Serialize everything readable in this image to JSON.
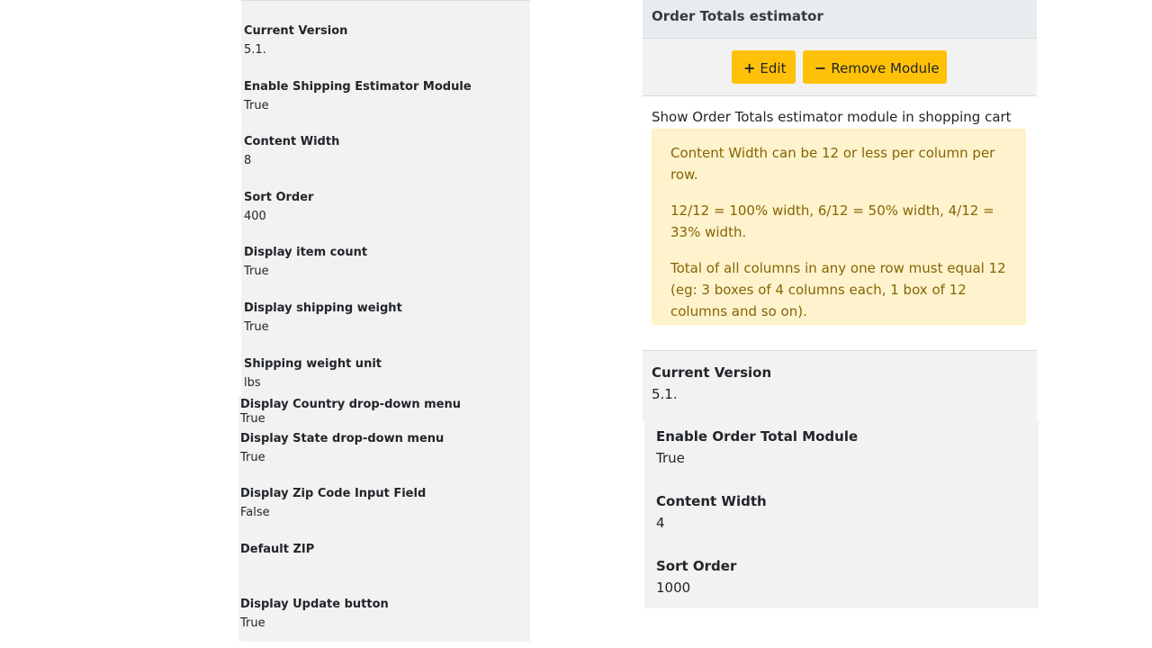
{
  "left_module": {
    "fields": [
      {
        "label": "Current Version",
        "value": "5.1."
      },
      {
        "label": "Enable Shipping Estimator Module",
        "value": "True"
      },
      {
        "label": "Content Width",
        "value": "8"
      },
      {
        "label": "Sort Order",
        "value": "400"
      },
      {
        "label": "Display item count",
        "value": "True"
      },
      {
        "label": "Display shipping weight",
        "value": "True"
      },
      {
        "label": "Shipping weight unit",
        "value": "lbs"
      },
      {
        "label": "Display Country drop-down menu",
        "value": "True"
      },
      {
        "label": "Display State drop-down menu",
        "value": "True"
      },
      {
        "label": "Display Zip Code Input Field",
        "value": "False"
      },
      {
        "label": "Default ZIP",
        "value": ""
      },
      {
        "label": "Display Update button",
        "value": "True"
      }
    ]
  },
  "right_module": {
    "title": "Order Totals estimator",
    "edit_label": "Edit",
    "remove_label": "Remove Module",
    "edit_icon": "plus-icon",
    "remove_icon": "minus-icon",
    "description": "Show Order Totals estimator module in shopping cart",
    "info": {
      "line1": "Content Width can be 12 or less per column per row.",
      "line2": "12/12 = 100% width, 6/12 = 50% width, 4/12 = 33% width.",
      "line3": "Total of all columns in any one row must equal 12 (eg: 3 boxes of 4 columns each, 1 box of 12 columns and so on)."
    },
    "fields": [
      {
        "label": "Current Version",
        "value": "5.1."
      },
      {
        "label": "Enable Order Total Module",
        "value": "True"
      },
      {
        "label": "Content Width",
        "value": "4"
      },
      {
        "label": "Sort Order",
        "value": "1000"
      }
    ]
  },
  "colors": {
    "button": "#ffc107",
    "info_bg": "#fff3cd",
    "info_text": "#856404",
    "panel_bg": "#f2f2f2",
    "header_bg": "#e9ecef"
  }
}
